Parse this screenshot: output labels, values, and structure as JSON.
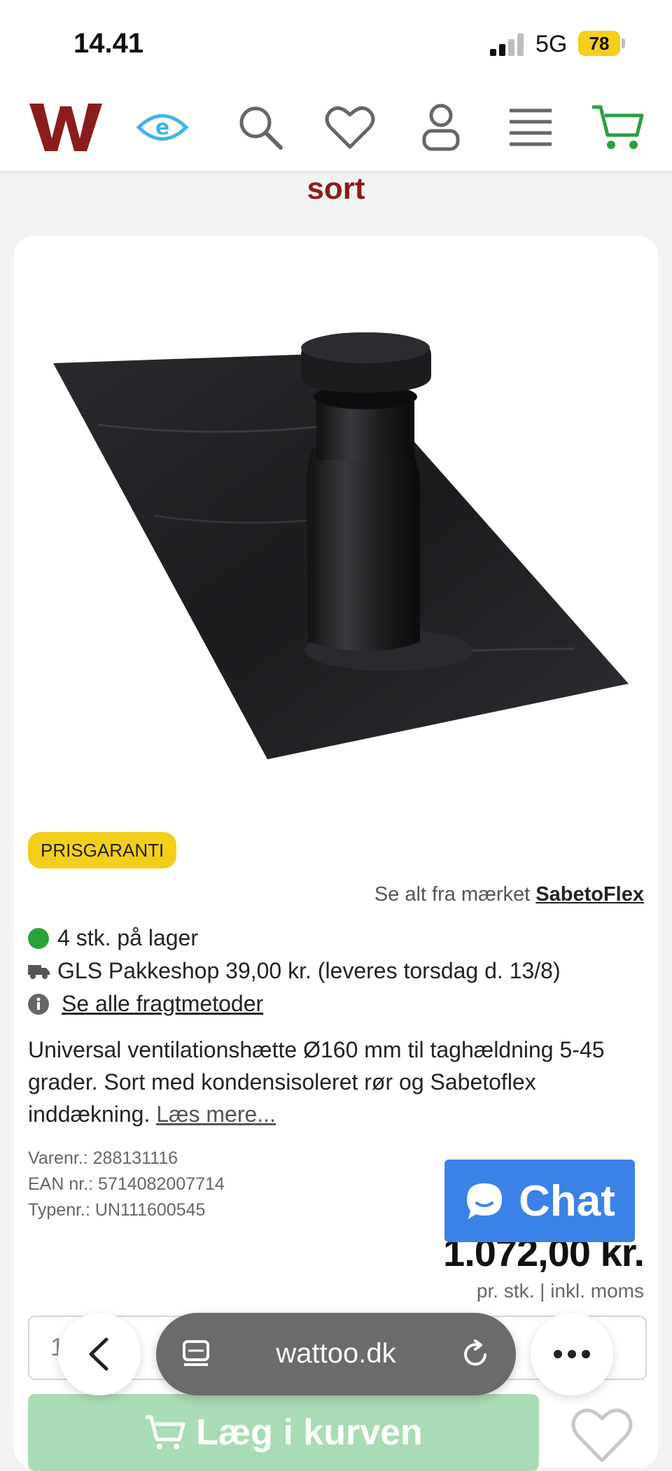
{
  "status_bar": {
    "time": "14.41",
    "network": "5G",
    "battery": "78"
  },
  "header": {
    "icons": [
      "logo-icon",
      "eye-icon",
      "search-icon",
      "heart-icon",
      "user-icon",
      "menu-icon",
      "cart-icon"
    ],
    "logo_letter": "W",
    "eye_letter": "e"
  },
  "page": {
    "subtitle": "sort"
  },
  "product": {
    "badge": "PRISGARANTI",
    "brand_prefix": "Se alt fra mærket",
    "brand_name": "SabetoFlex",
    "stock": "4 stk. på lager",
    "shipping": "GLS Pakkeshop 39,00 kr. (leveres torsdag d. 13/8)",
    "shipping_methods_link": "Se alle fragtmetoder",
    "description": "Universal ventilationshætte Ø160 mm til taghældning 5-45 grader. Sort med kondensisoleret rør og Sabetoflex inddækning.",
    "read_more": "Læs mere...",
    "varenr": "Varenr.: 288131116",
    "ean": "EAN nr.: 5714082007714",
    "typenr": "Typenr.: UN111600545",
    "price": "1.072,00 kr.",
    "price_note": "pr. stk. | inkl. moms",
    "quantity": "1",
    "add_to_cart": "Læg i kurven"
  },
  "chat": {
    "label": "Chat"
  },
  "browser": {
    "url": "wattoo.dk"
  },
  "colors": {
    "brand": "#8b1c1c",
    "eye": "#3fb4e6",
    "cart": "#2e9e46",
    "badge": "#f4cf1a",
    "stock": "#2aa23a",
    "chat": "#3b82e6"
  }
}
